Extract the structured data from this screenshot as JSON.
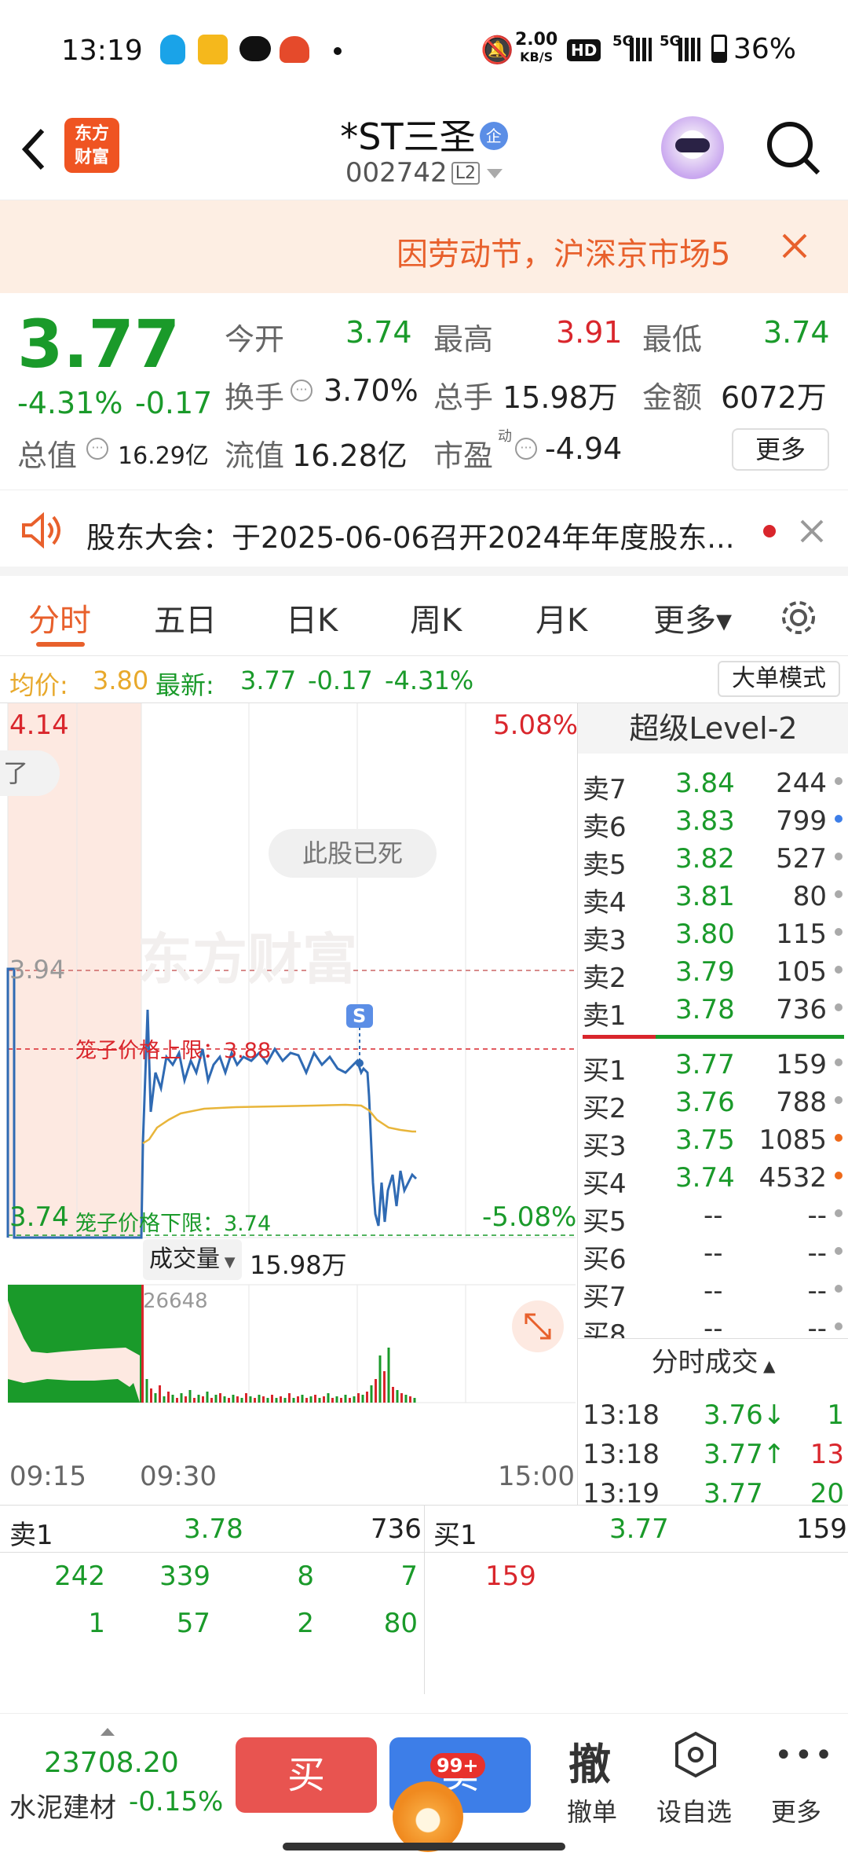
{
  "status_bar": {
    "time": "13:19",
    "net_speed_top": "2.00",
    "net_speed_bottom": "KB/S",
    "hd": "HD",
    "sig1": "5G",
    "sig2": "5G",
    "battery": "36%"
  },
  "header": {
    "logo_line1": "东方",
    "logo_line2": "财富",
    "title": "*ST三圣",
    "title_badge": "企",
    "code": "002742",
    "level_badge": "L2"
  },
  "banner": {
    "text": "因劳动节，沪深京市场5"
  },
  "quote": {
    "price": "3.77",
    "change_pct": "-4.31%",
    "change": "-0.17",
    "open_label": "今开",
    "open": "3.74",
    "high_label": "最高",
    "high": "3.91",
    "low_label": "最低",
    "low": "3.74",
    "turnover_label": "换手",
    "turnover": "3.70%",
    "volume_label": "总手",
    "volume": "15.98万",
    "amount_label": "金额",
    "amount": "6072万",
    "mktcap_label": "总值",
    "mktcap": "16.29亿",
    "float_label": "流值",
    "float": "16.28亿",
    "pe_label": "市盈",
    "pe_sup": "动",
    "pe": "-4.94",
    "more_button": "更多"
  },
  "notice": {
    "text": "股东大会：于2025-06-06召开2024年年度股东..."
  },
  "tabs": [
    {
      "label": "分时"
    },
    {
      "label": "五日"
    },
    {
      "label": "日K"
    },
    {
      "label": "周K"
    },
    {
      "label": "月K"
    },
    {
      "label": "更多▾"
    }
  ],
  "avg_line": {
    "avg_label": "均价:",
    "avg": "3.80",
    "latest_label": "最新:",
    "latest": "3.77",
    "chg": "-0.17",
    "pct": "-4.31%",
    "mode_button": "大单模式"
  },
  "chart": {
    "top_price": "4.14",
    "top_pct": "5.08%",
    "mid_price": "3.94",
    "bottom_price": "3.74",
    "bottom_pct": "-5.08%",
    "cage_upper_label": "笼子价格上限：3.88",
    "cage_lower_label": "笼子价格下限：3.74",
    "bubble_text": "此股已死",
    "side_tag": "了",
    "signal": "S",
    "watermark": "东方财富",
    "vol_label": "成交量",
    "vol_total": "15.98万",
    "vol_max": "26648",
    "time_start": "09:15",
    "time_open": "09:30",
    "time_end": "15:00",
    "colors": {
      "up": "#d9262c",
      "down": "#1a9a2a",
      "price_line": "#2f6ab3",
      "avg_line": "#e8b53a"
    }
  },
  "book": {
    "title": "超级Level-2",
    "asks": [
      {
        "label": "卖7",
        "price": "3.84",
        "vol": "244"
      },
      {
        "label": "卖6",
        "price": "3.83",
        "vol": "799"
      },
      {
        "label": "卖5",
        "price": "3.82",
        "vol": "527"
      },
      {
        "label": "卖4",
        "price": "3.81",
        "vol": "80"
      },
      {
        "label": "卖3",
        "price": "3.80",
        "vol": "115"
      },
      {
        "label": "卖2",
        "price": "3.79",
        "vol": "105"
      },
      {
        "label": "卖1",
        "price": "3.78",
        "vol": "736"
      }
    ],
    "bids": [
      {
        "label": "买1",
        "price": "3.77",
        "vol": "159"
      },
      {
        "label": "买2",
        "price": "3.76",
        "vol": "788"
      },
      {
        "label": "买3",
        "price": "3.75",
        "vol": "1085"
      },
      {
        "label": "买4",
        "price": "3.74",
        "vol": "4532"
      },
      {
        "label": "买5",
        "price": "--",
        "vol": "--"
      },
      {
        "label": "买6",
        "price": "--",
        "vol": "--"
      },
      {
        "label": "买7",
        "price": "--",
        "vol": "--"
      },
      {
        "label": "买8",
        "price": "--",
        "vol": "--"
      }
    ],
    "trades_title": "分时成交",
    "trades": [
      {
        "time": "13:18",
        "price": "3.76↓",
        "vol": "1"
      },
      {
        "time": "13:18",
        "price": "3.77↑",
        "vol": "13"
      },
      {
        "time": "13:19",
        "price": "3.77",
        "vol": "20"
      }
    ]
  },
  "queue": {
    "sell_label": "卖1",
    "sell_price": "3.78",
    "sell_vol": "736",
    "buy_label": "买1",
    "buy_price": "3.77",
    "buy_vol": "159",
    "sell_row1": [
      "242",
      "339",
      "8",
      "7"
    ],
    "sell_row2": [
      "1",
      "57",
      "2",
      "80"
    ],
    "buy_row1": [
      "159"
    ]
  },
  "footer": {
    "index_value": "23708.20",
    "index_name": "水泥建材",
    "index_pct": "-0.15%",
    "buy_button": "买",
    "sell_button": "卖",
    "sell_badge": "99+",
    "cancel_icon_char": "撤",
    "cancel_label": "撤单",
    "watch_label": "设自选",
    "more_label": "更多"
  }
}
